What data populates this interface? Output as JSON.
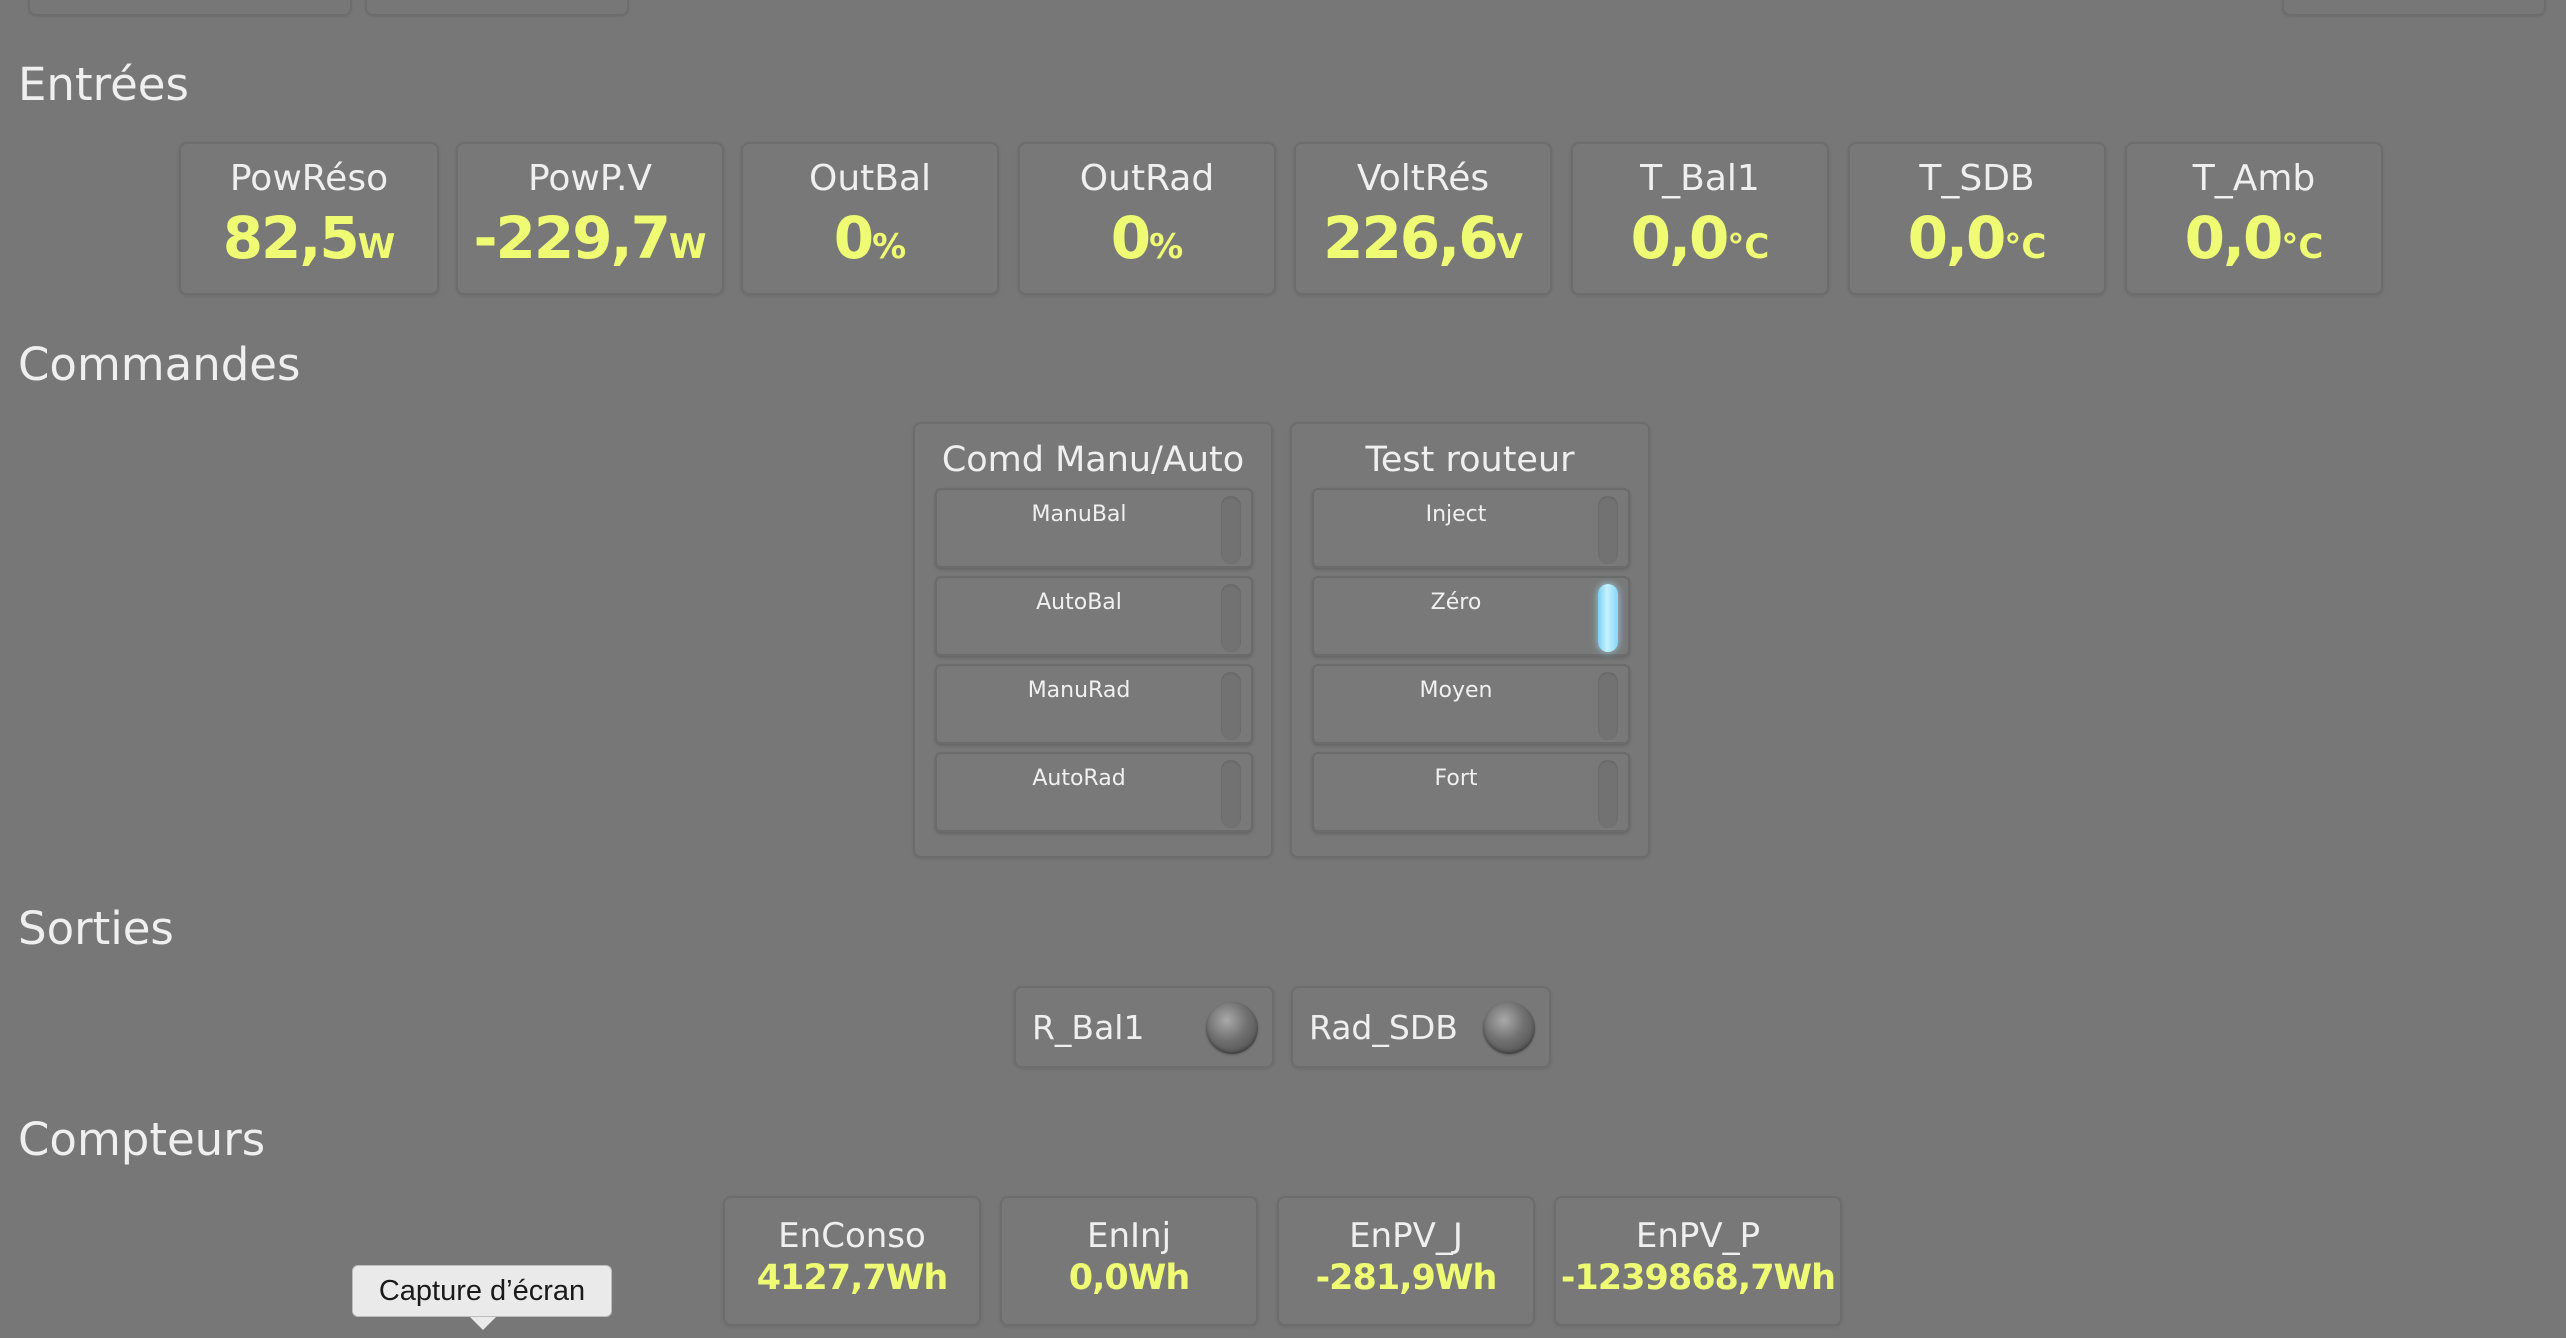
{
  "sections": {
    "inputs": "Entrées",
    "commands": "Commandes",
    "outputs": "Sorties",
    "counters": "Compteurs"
  },
  "inputs": [
    {
      "label": "PowRéso",
      "value": "82,5",
      "unit": "W"
    },
    {
      "label": "PowP.V",
      "value": "-229,7",
      "unit": "W"
    },
    {
      "label": "OutBal",
      "value": "0",
      "unit": "%"
    },
    {
      "label": "OutRad",
      "value": "0",
      "unit": "%"
    },
    {
      "label": "VoltRés",
      "value": "226,6",
      "unit": "V"
    },
    {
      "label": "T_Bal1",
      "value": "0,0",
      "unit": "°C"
    },
    {
      "label": "T_SDB",
      "value": "0,0",
      "unit": "°C"
    },
    {
      "label": "T_Amb",
      "value": "0,0",
      "unit": "°C"
    }
  ],
  "commands": [
    {
      "title": "Comd Manu/Auto",
      "buttons": [
        {
          "label": "ManuBal",
          "active": false
        },
        {
          "label": "AutoBal",
          "active": false
        },
        {
          "label": "ManuRad",
          "active": false
        },
        {
          "label": "AutoRad",
          "active": false
        }
      ]
    },
    {
      "title": "Test routeur",
      "buttons": [
        {
          "label": "Inject",
          "active": false
        },
        {
          "label": "Zéro",
          "active": true
        },
        {
          "label": "Moyen",
          "active": false
        },
        {
          "label": "Fort",
          "active": false
        }
      ]
    }
  ],
  "outputs": [
    {
      "label": "R_Bal1",
      "state": "off"
    },
    {
      "label": "Rad_SDB",
      "state": "off"
    }
  ],
  "counters": [
    {
      "label": "EnConso",
      "value": "4127,7Wh"
    },
    {
      "label": "EnInj",
      "value": "0,0Wh"
    },
    {
      "label": "EnPV_J",
      "value": "-281,9Wh"
    },
    {
      "label": "EnPV_P",
      "value": "-1239868,7Wh"
    }
  ],
  "tooltip": "Capture d’écran",
  "colors": {
    "background": "#777777",
    "value": "#eefb73",
    "indicator_on": "#a9e6fb"
  }
}
